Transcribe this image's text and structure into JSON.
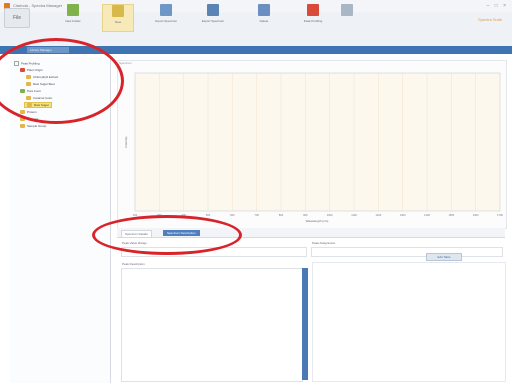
{
  "window": {
    "title": "Clarinda - Spectra Manager",
    "controls": "– □ ×"
  },
  "ribbon": {
    "file_label": "File",
    "tools": [
      {
        "label": "New Folder",
        "color": "#7fb24a"
      },
      {
        "label": "New",
        "color": "#d8b84a"
      },
      {
        "label": "Import Spectrum",
        "color": "#6d97c5"
      },
      {
        "label": "Export Spectrum",
        "color": "#5b84b5"
      },
      {
        "label": "Delete",
        "color": "#6b8fc0"
      },
      {
        "label": "Peak Profiling",
        "color": "#d84a3a"
      }
    ],
    "brand": "Spectra Suite"
  },
  "nav": {
    "tab_label": "Library Manager"
  },
  "tree": {
    "items": [
      {
        "label": "Peak Profiling",
        "color": "#e2b64a"
      },
      {
        "label": "Plant Origin",
        "color": "#d84a3a"
      },
      {
        "label": "Chlorophyll Extract",
        "color": "#e2b64a"
      },
      {
        "label": "Raw Sugar Beet",
        "color": "#e2b64a"
      },
      {
        "label": "Pure Form",
        "color": "#7fb24a"
      },
      {
        "label": "Caramel Color",
        "color": "#e2b64a"
      },
      {
        "label": "Raw Sugar",
        "color": "#e2b64a"
      },
      {
        "label": "Protein",
        "color": "#e2b64a"
      },
      {
        "label": "Minerals",
        "color": "#e2b64a"
      },
      {
        "label": "Sample Group",
        "color": "#e2b64a"
      }
    ]
  },
  "chart": {
    "header": "Spectrum",
    "ylabel": "Intensity",
    "xlabel": "Wavelength (nm)",
    "ticks": [
      "200",
      "300",
      "400",
      "500",
      "600",
      "700",
      "800",
      "900",
      "1000",
      "1100",
      "1200",
      "1300",
      "1400",
      "1500",
      "1600",
      "1700"
    ]
  },
  "subtabs": {
    "tab1": "Spectrum Details",
    "tab2": "Spectrum Description"
  },
  "form": {
    "left_label": "Peak Value Range",
    "right_label": "Peak Assignment",
    "desc_label": "Peak Description",
    "button_label": "Edit Table"
  }
}
